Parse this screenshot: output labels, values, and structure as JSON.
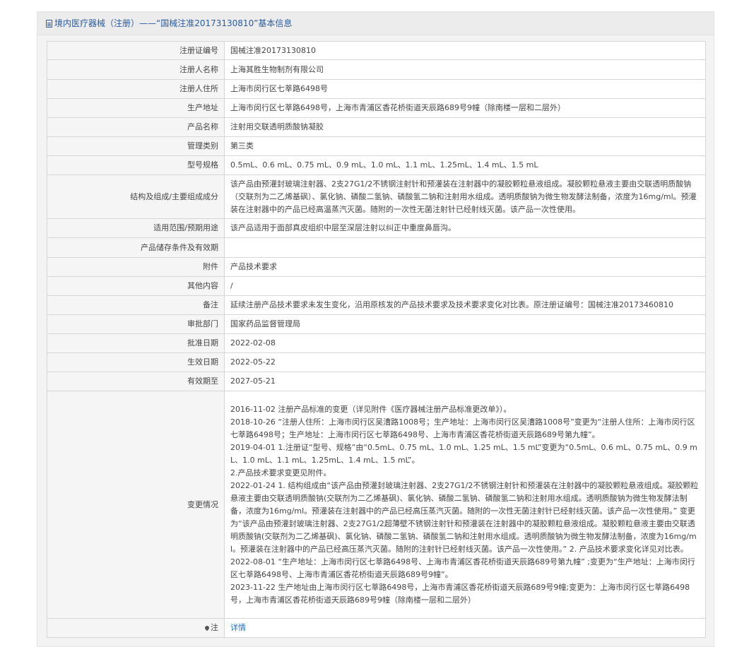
{
  "header": {
    "title": "境内医疗器械（注册）——“国械注准20173130810”基本信息",
    "icon": "document-icon"
  },
  "rows": [
    {
      "label": "注册证编号",
      "value": "国械注准20173130810"
    },
    {
      "label": "注册人名称",
      "value": "上海其胜生物制剂有限公司"
    },
    {
      "label": "注册人住所",
      "value": "上海市闵行区七莘路6498号"
    },
    {
      "label": "生产地址",
      "value": "上海市闵行区七莘路6498号，上海市青浦区香花桥街道天辰路689号9幢（除南楼一层和二层外）"
    },
    {
      "label": "产品名称",
      "value": "注射用交联透明质酸钠凝胶"
    },
    {
      "label": "管理类别",
      "value": "第三类"
    },
    {
      "label": "型号规格",
      "value": "0.5mL、0.6 mL、0.75 mL、0.9 mL、1.0 mL、1.1 mL、1.25mL、1.4 mL、1.5 mL"
    },
    {
      "label": "结构及组成/主要组成成分",
      "value": "该产品由预灌封玻璃注射器、2支27G1/2不锈钢注射针和预灌装在注射器中的凝胶颗粒悬液组成。凝胶颗粒悬液主要由交联透明质酸钠（交联剂为二乙烯基砜）、氯化钠、磷酸二氢钠、磷酸氢二钠和注射用水组成。透明质酸钠为微生物发酵法制备，浓度为16mg/ml。预灌装在注射器中的产品已经高温蒸汽灭菌。随附的一次性无菌注射针已经射线灭菌。该产品一次性使用。"
    },
    {
      "label": "适用范围/预期用途",
      "value": "该产品适用于面部真皮组织中层至深层注射以纠正中重度鼻唇沟。"
    },
    {
      "label": "产品储存条件及有效期",
      "value": ""
    },
    {
      "label": "附件",
      "value": "产品技术要求"
    },
    {
      "label": "其他内容",
      "value": "/"
    },
    {
      "label": "备注",
      "value": "延续注册产品技术要求未发生变化，沿用原核发的产品技术要求及技术要求变化对比表。原注册证编号：国械注准20173460810"
    },
    {
      "label": "审批部门",
      "value": "国家药品监督管理局"
    },
    {
      "label": "批准日期",
      "value": "2022-02-08"
    },
    {
      "label": "生效日期",
      "value": "2022-05-22"
    },
    {
      "label": "有效期至",
      "value": "2027-05-21"
    }
  ],
  "changes": {
    "label": "变更情况",
    "lines": [
      "2016-11-02 注册产品标准的变更（详见附件《医疗器械注册产品标准更改单》）。",
      "2018-10-26 “注册人住所：上海市闵行区吴漕路1008号；生产地址：上海市闵行区吴漕路1008号”变更为“注册人住所：上海市闵行区七莘路6498号；生产地址：上海市闵行区七莘路6498号、上海市青浦区香花桥街道天辰路689号第九幢”。",
      "2019-04-01 1.注册证“型号、规格”由“0.5mL、0.75 mL、1.0 mL、1.25 mL、1.5 mL”变更为“0.5mL、0.6 mL、0.75 mL、0.9 mL、1.0 mL、1.1 mL、1.25mL、1.4 mL、1.5 mL”。",
      "2.产品技术要求变更见附件。",
      "2022-01-24 1. 结构组成由“该产品由预灌封玻璃注射器、2支27G1/2不锈钢注射针和预灌装在注射器中的凝胶颗粒悬液组成。凝胶颗粒悬液主要由交联透明质酸钠(交联剂为二乙烯基砜)、氯化钠、磷酸二氢钠、磷酸氢二钠和注射用水组成。透明质酸钠为微生物发酵法制备，浓度为16mg/ml。预灌装在注射器中的产品已经高压蒸汽灭菌。随附的一次性无菌注射针已经射线灭菌。该产品一次性使用。” 变更为“该产品由预灌封玻璃注射器、2支27G1/2超薄壁不锈钢注射针和预灌装在注射器中的凝胶颗粒悬液组成。凝胶颗粒悬液主要由交联透明质酸钠(交联剂为二乙烯基砜)、氯化钠、磷酸二氢钠、磷酸氢二钠和注射用水组成。透明质酸钠为微生物发酵法制备，浓度为16mg/ml。预灌装在注射器中的产品已经高压蒸汽灭菌。随附的注射针已经射线灭菌。该产品一次性使用。” 2. 产品技术要求变化详见对比表。",
      "2022-08-01 “生产地址：上海市闵行区七莘路6498号、上海市青浦区香花桥街道天辰路689号第九幢” ;变更为“生产地址：上海市闵行区七莘路6498号、上海市青浦区香花桥街道天辰路689号9幢”。",
      "2023-11-22 生产地址由上海市闵行区七莘路6498号，上海市青浦区香花桥街道天辰路689号9幢;变更为：上海市闵行区七莘路6498号，上海市青浦区香花桥街道天辰路689号9幢（除南楼一层和二层外）"
    ]
  },
  "note": {
    "label": "注",
    "icon": "location-pin-icon",
    "link": "详情",
    "link_color": "#1a6fc4"
  }
}
